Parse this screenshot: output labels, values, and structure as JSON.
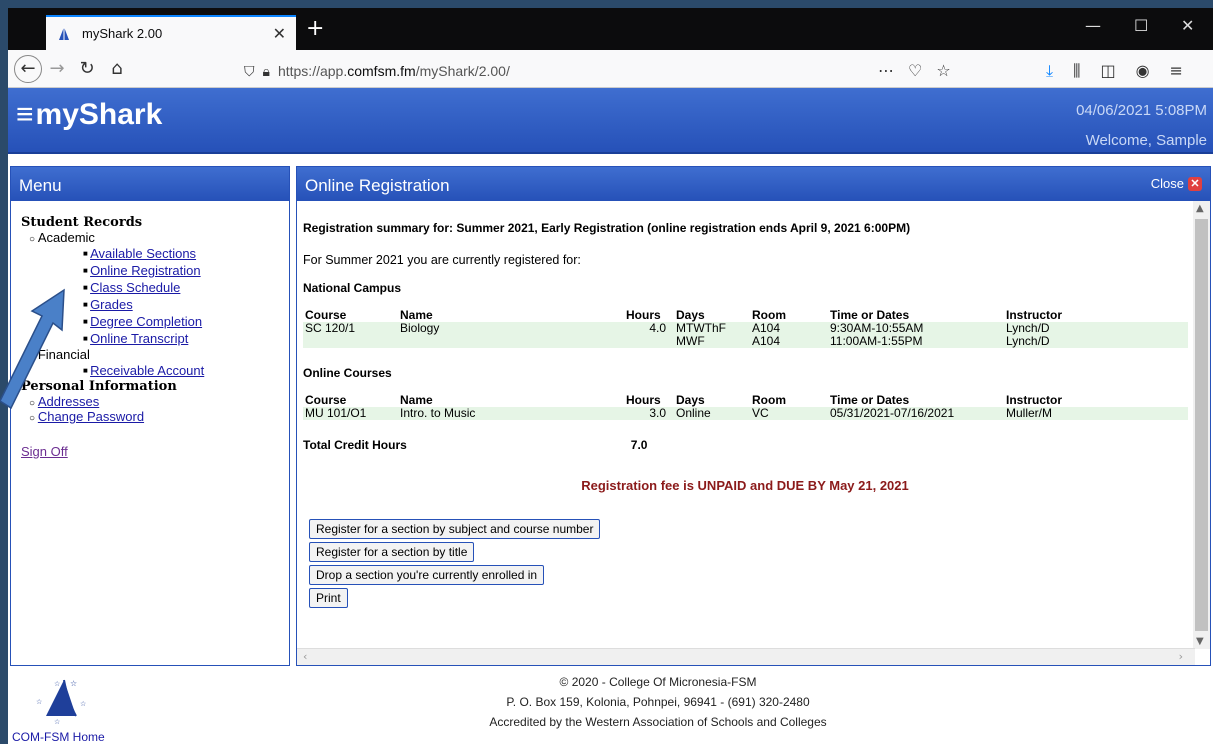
{
  "browser": {
    "tab_title": "myShark 2.00",
    "url_prefix": "https://app.",
    "url_domain": "comfsm.fm",
    "url_path": "/myShark/2.00/"
  },
  "header": {
    "brand": "myShark",
    "datetime": "04/06/2021 5:08PM",
    "welcome": "Welcome, Sample"
  },
  "menu": {
    "title": "Menu",
    "student_records": "Student Records",
    "academic": "Academic",
    "academic_items": [
      "Available Sections",
      "Online Registration",
      "Class Schedule",
      "Grades",
      "Degree Completion",
      "Online Transcript"
    ],
    "financial": "Financial",
    "financial_items": [
      "Receivable Account"
    ],
    "personal_info": "Personal Information",
    "personal_items": [
      "Addresses",
      "Change Password"
    ],
    "sign_off": "Sign Off"
  },
  "registration": {
    "title": "Online Registration",
    "close_label": "Close",
    "summary": "Registration summary for: Summer 2021, Early Registration (online registration ends April 9, 2021 6:00PM)",
    "intro": "For Summer 2021 you are currently registered for:",
    "columns": [
      "Course",
      "Name",
      "Hours",
      "Days",
      "Room",
      "Time or Dates",
      "Instructor"
    ],
    "national_campus": {
      "heading": "National Campus",
      "rows": [
        {
          "course": "SC 120/1",
          "name": "Biology",
          "hours": "4.0",
          "days": "MTWThF",
          "room": "A104",
          "time": "9:30AM-10:55AM",
          "instructor": "Lynch/D"
        },
        {
          "course": "",
          "name": "",
          "hours": "",
          "days": "MWF",
          "room": "A104",
          "time": "11:00AM-1:55PM",
          "instructor": "Lynch/D"
        }
      ]
    },
    "online_courses": {
      "heading": "Online Courses",
      "rows": [
        {
          "course": "MU 101/O1",
          "name": "Intro. to Music",
          "hours": "3.0",
          "days": "Online",
          "room": "VC",
          "time": "05/31/2021-07/16/2021",
          "instructor": "Muller/M"
        }
      ]
    },
    "total_label": "Total Credit Hours",
    "total_value": "7.0",
    "fee_notice": "Registration fee is UNPAID and DUE BY May 21, 2021",
    "buttons": {
      "by_subject": "Register for a section by subject and course number",
      "by_title": "Register for a section by title",
      "drop": "Drop a section you're currently enrolled in",
      "print": "Print"
    }
  },
  "footer": {
    "home_link": "COM-FSM Home",
    "line1": "© 2020 - College Of Micronesia-FSM",
    "line2": "P. O. Box 159, Kolonia, Pohnpei, 96941 - (691) 320-2480",
    "line3": "Accredited by the Western Association of Schools and Colleges"
  },
  "colors": {
    "header_blue": "#2651b8",
    "row_green": "#e6f5e6",
    "fee_red": "#8b1a1a",
    "link_blue": "#1a1aa6"
  }
}
